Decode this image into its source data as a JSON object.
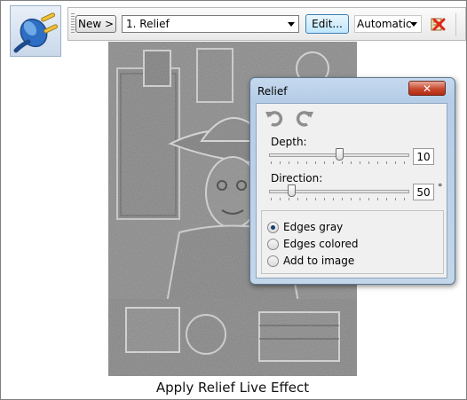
{
  "toolbar": {
    "new_label": "New >",
    "effect_select_value": "1. Relief",
    "edit_label": "Edit...",
    "resolution_select_value": "Automatic"
  },
  "dialog": {
    "title": "Relief",
    "close_label": "✕",
    "depth_label": "Depth:",
    "depth_value": "10",
    "depth_fraction": 0.5,
    "direction_label": "Direction:",
    "direction_value": "50",
    "direction_unit": "°",
    "direction_fraction": 0.14,
    "options": [
      {
        "label": "Edges gray",
        "selected": true
      },
      {
        "label": "Edges colored",
        "selected": false
      },
      {
        "label": "Add to image",
        "selected": false
      }
    ]
  },
  "caption": "Apply Relief Live Effect",
  "icons": [
    "plug-icon",
    "delete-effect-icon",
    "undo-icon",
    "redo-icon"
  ],
  "colors": {
    "accent": "#3c7fb1",
    "close": "#c8492f"
  }
}
